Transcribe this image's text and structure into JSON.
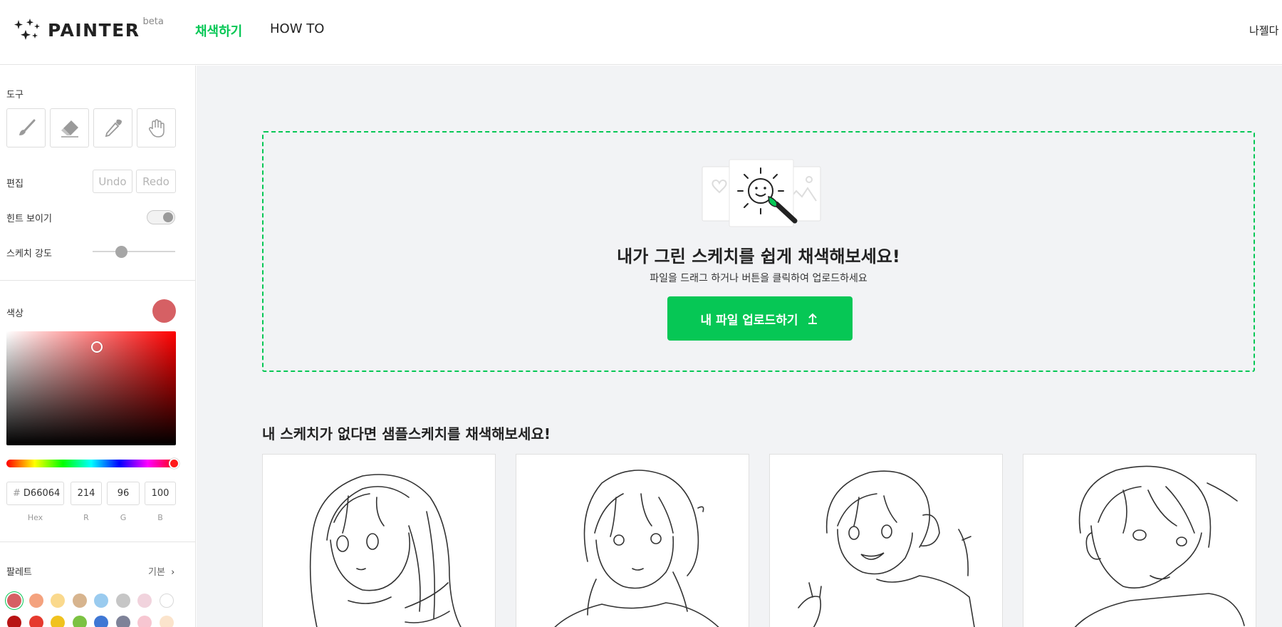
{
  "header": {
    "logo_text": "PAINTER",
    "logo_badge": "beta",
    "nav": [
      {
        "label": "채색하기",
        "active": true
      },
      {
        "label": "HOW TO",
        "active": false
      }
    ],
    "user_name": "나젤다 님"
  },
  "sidebar": {
    "tools_label": "도구",
    "tools": [
      "brush-icon",
      "eraser-icon",
      "eyedropper-icon",
      "hand-icon"
    ],
    "edit_label": "편집",
    "undo_label": "Undo",
    "redo_label": "Redo",
    "hint_label": "힌트 보이기",
    "hint_on": true,
    "sketch_strength_label": "스케치 강도",
    "sketch_strength": 0.35,
    "color_label": "색상",
    "current_color": "#D66064",
    "hex_prefix": "#",
    "hex": "D66064",
    "r": "214",
    "g": "96",
    "b": "100",
    "hex_caption": "Hex",
    "r_caption": "R",
    "g_caption": "G",
    "b_caption": "B",
    "palette_label": "팔레트",
    "palette_mode": "기본",
    "palette_row1": [
      "#D66064",
      "#F4A27E",
      "#FAD98D",
      "#D7B48E",
      "#9ACBEF",
      "#C6C6C6",
      "#F1D3DD",
      "#FFFFFF"
    ],
    "palette_row2": [
      "#B81414",
      "#E63A2E",
      "#F0C21F",
      "#7CC242",
      "#3F77D4",
      "#7E8298",
      "#F7C6D1",
      "#FBE4CC"
    ]
  },
  "main": {
    "dropzone_title": "내가 그린 스케치를 쉽게 채색해보세요!",
    "dropzone_subtitle": "파일을 드래그 하거나 버튼을 클릭하여 업로드하세요",
    "upload_button": "내 파일 업로드하기",
    "samples_title": "내 스케치가 없다면 샘플스케치를 채색해보세요!",
    "accent_color": "#06C755"
  }
}
